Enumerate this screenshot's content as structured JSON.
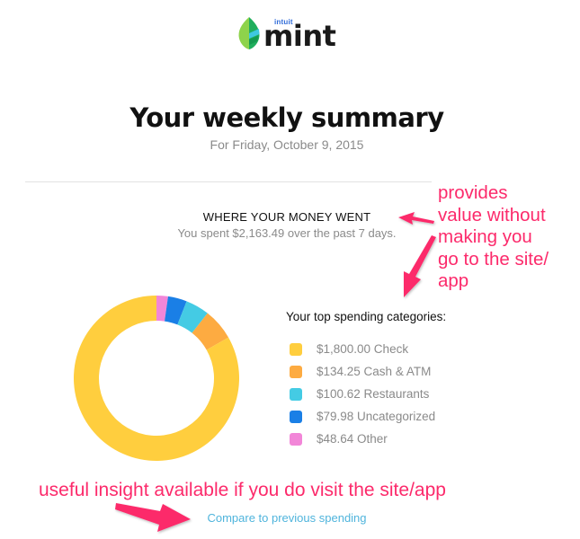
{
  "logo": {
    "brand_small": "intuit",
    "brand_main": "mint",
    "icon": "mint-leaf-icon"
  },
  "header": {
    "title": "Your weekly summary",
    "date": "For Friday, October 9, 2015"
  },
  "section": {
    "heading": "WHERE YOUR MONEY WENT",
    "subtitle": "You spent $2,163.49 over the past 7 days."
  },
  "legend": {
    "title": "Your top spending categories:",
    "items": [
      {
        "label": "$1,800.00 Check",
        "color": "#ffce3e"
      },
      {
        "label": "$134.25 Cash & ATM",
        "color": "#fdab41"
      },
      {
        "label": "$100.62 Restaurants",
        "color": "#44cbe4"
      },
      {
        "label": "$79.98 Uncategorized",
        "color": "#1a7fe6"
      },
      {
        "label": "$48.64 Other",
        "color": "#f286d8"
      }
    ]
  },
  "chart_data": {
    "type": "pie",
    "variant": "donut",
    "title": "Your top spending categories",
    "start": "top",
    "direction": "counterclockwise-from-top",
    "categories": [
      "Check",
      "Cash & ATM",
      "Restaurants",
      "Uncategorized",
      "Other"
    ],
    "values": [
      1800.0,
      134.25,
      100.62,
      79.98,
      48.64
    ],
    "colors": [
      "#ffce3e",
      "#fdab41",
      "#44cbe4",
      "#1a7fe6",
      "#f286d8"
    ],
    "total": 2163.49
  },
  "link": {
    "label": "Compare to previous spending"
  },
  "annotations": {
    "right_lines": [
      "provides",
      "value without",
      "making you",
      "go to the site/",
      "app"
    ],
    "bottom": "useful insight available if you do visit the site/app",
    "color": "#fc2a6b"
  }
}
